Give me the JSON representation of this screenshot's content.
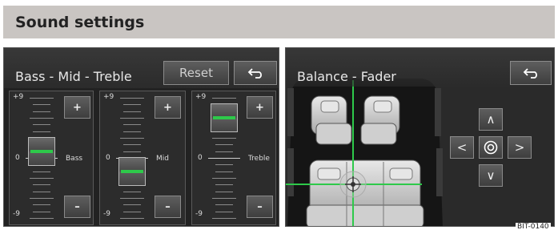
{
  "header": {
    "title": "Sound settings"
  },
  "equalizer": {
    "title": "Bass - Mid - Treble",
    "reset_label": "Reset",
    "back_icon": "back-arrow-icon",
    "max_label": "+9",
    "zero_label": "0",
    "min_label": "-9",
    "plus_label": "+",
    "minus_label": "–",
    "bands": [
      {
        "name": "Bass",
        "value": 1
      },
      {
        "name": "Mid",
        "value": -2
      },
      {
        "name": "Treble",
        "value": 6
      }
    ]
  },
  "balance": {
    "title": "Balance - Fader",
    "back_icon": "back-arrow-icon",
    "up_label": "∧",
    "down_label": "∨",
    "left_label": "<",
    "right_label": ">",
    "center_icon": "center-target-icon",
    "accent_color": "#2ec94a"
  },
  "figure_ref": "BIT-0140"
}
